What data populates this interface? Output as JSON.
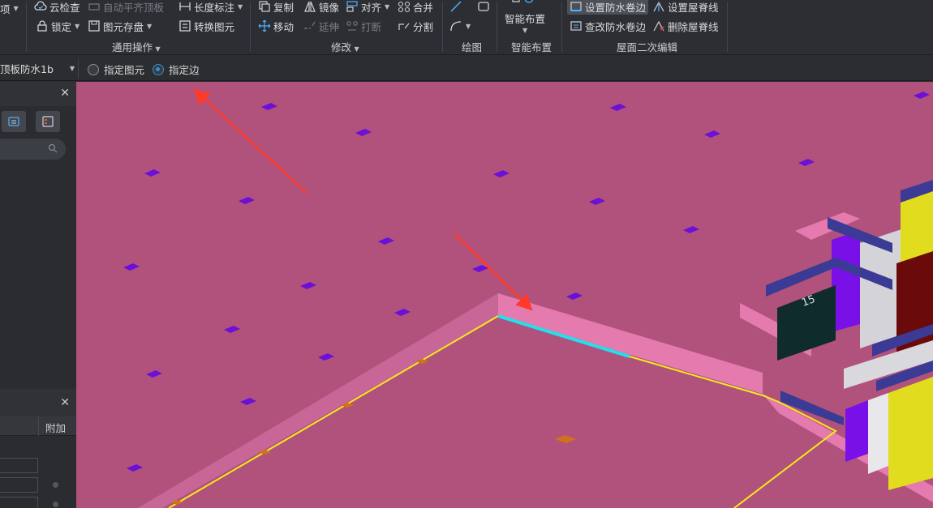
{
  "ribbon": {
    "partial_left_label": "项",
    "common_ops": {
      "title": "通用操作",
      "cloud_check": "云检查",
      "auto_flat_top": "自动平齐顶板",
      "length_dim": "长度标注",
      "lock": "锁定",
      "element_save": "图元存盘",
      "convert_element": "转换图元"
    },
    "modify": {
      "title": "修改",
      "copy": "复制",
      "mirror": "镜像",
      "align": "对齐",
      "merge": "合并",
      "move": "移动",
      "extend": "延伸",
      "break": "打断",
      "split": "分割"
    },
    "draw": {
      "title": "绘图"
    },
    "smart": {
      "title": "智能布置",
      "button": "智能布置"
    },
    "roof": {
      "title": "屋面二次编辑",
      "set_rollup": "设置防水卷边",
      "set_ridge": "设置屋脊线",
      "edit_rollup": "查改防水卷边",
      "delete_ridge": "删除屋脊线"
    }
  },
  "optbar": {
    "layer_value": "顶板防水1b",
    "radio_element": "指定图元",
    "radio_edge": "指定边",
    "selected": "指定边"
  },
  "panel": {
    "attr_column": "附加"
  },
  "colors": {
    "viewport_bg": "#b1527c",
    "selection": "#f5ea1a",
    "highlight_edge": "#22e0ec",
    "arrow": "#ff3a2a"
  }
}
